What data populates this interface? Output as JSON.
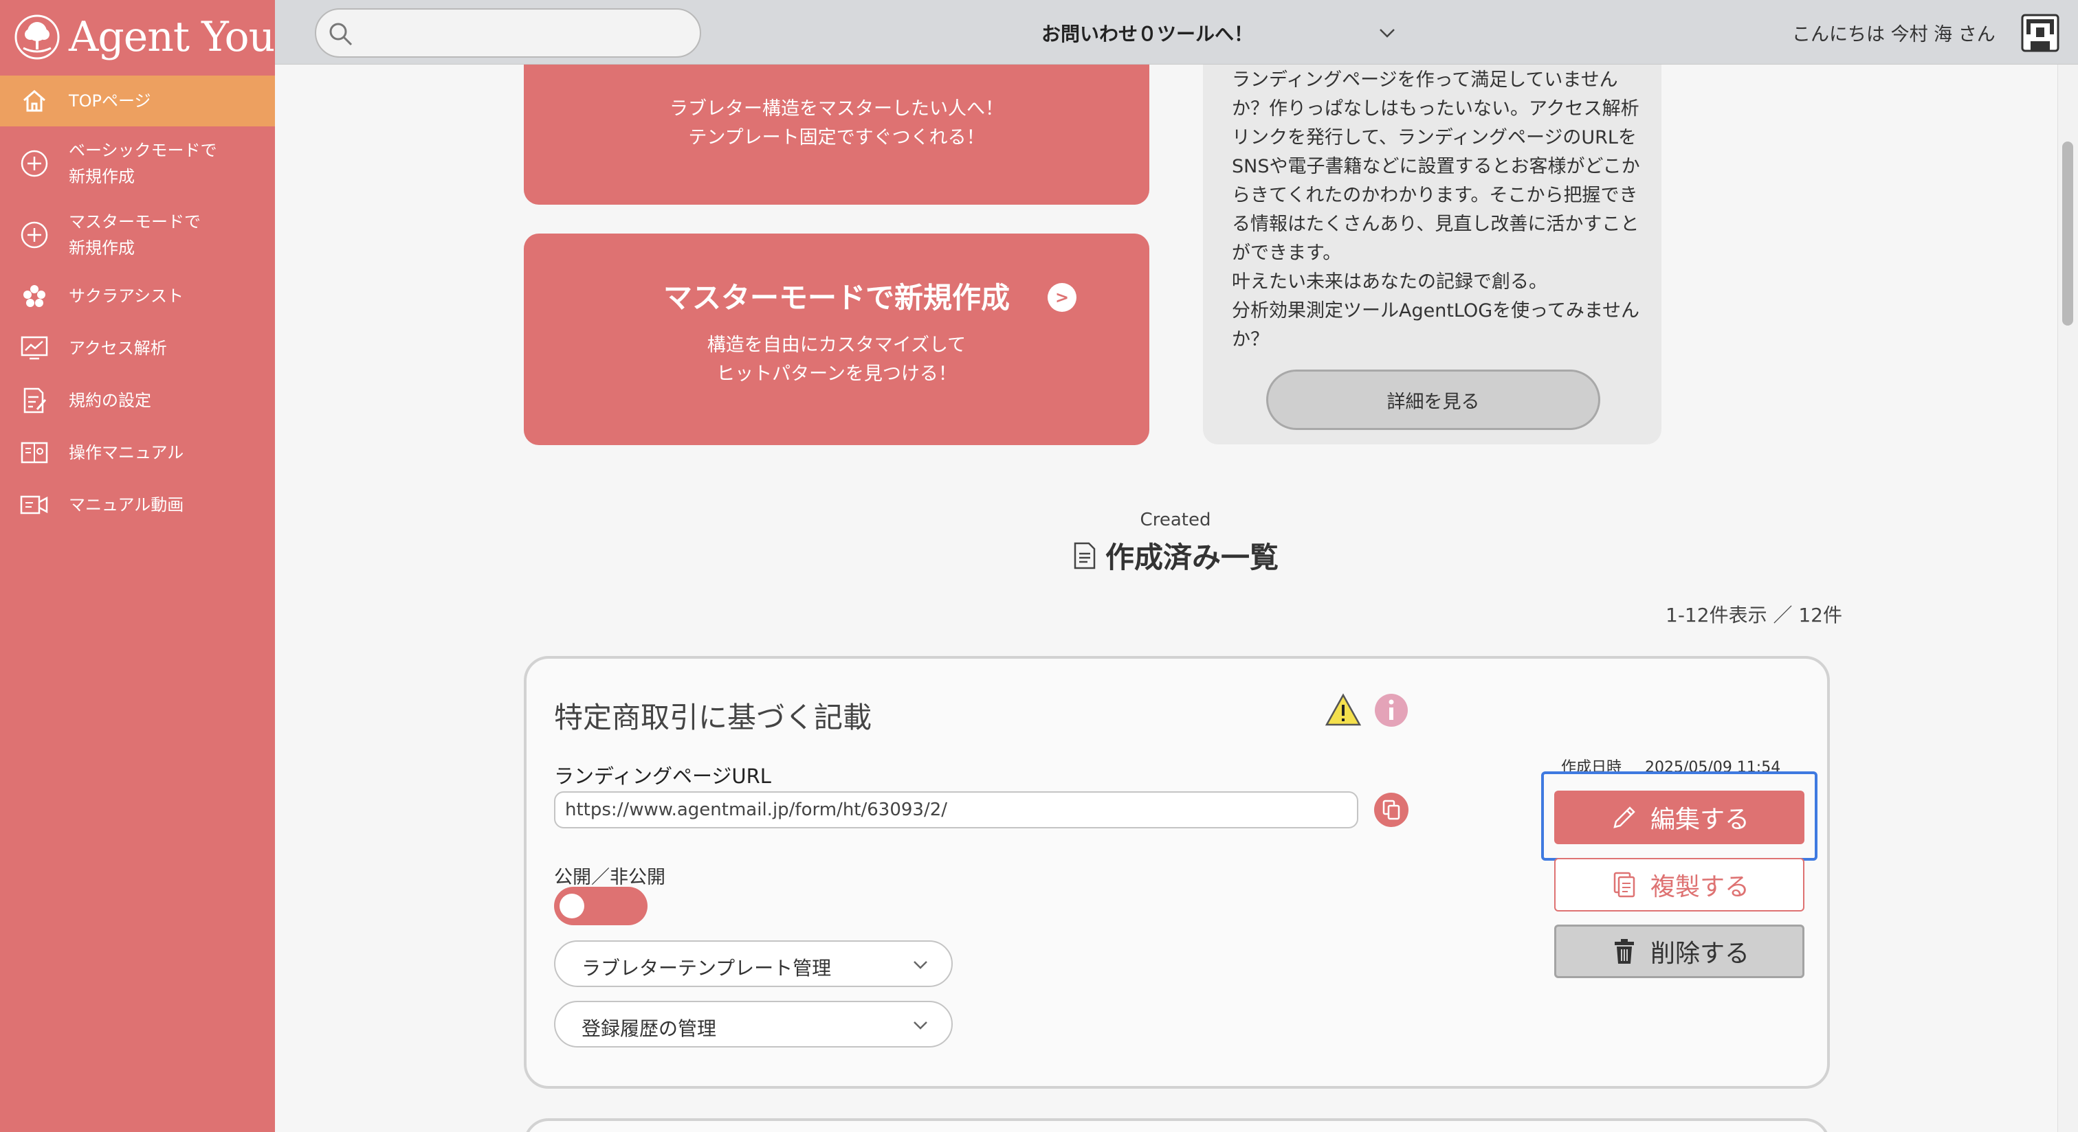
{
  "app": {
    "logo_text": "Agent You"
  },
  "sidebar": {
    "items": [
      {
        "label": "TOPページ",
        "icon": "home-icon",
        "active": true
      },
      {
        "label": "ベーシックモードで\n新規作成",
        "icon": "plus-circle-icon"
      },
      {
        "label": "マスターモードで\n新規作成",
        "icon": "plus-circle-icon"
      },
      {
        "label": "サクラアシスト",
        "icon": "sakura-icon"
      },
      {
        "label": "アクセス解析",
        "icon": "analytics-icon"
      },
      {
        "label": "規約の設定",
        "icon": "document-edit-icon"
      },
      {
        "label": "操作マニュアル",
        "icon": "manual-icon"
      },
      {
        "label": "マニュアル動画",
        "icon": "video-icon"
      }
    ]
  },
  "topbar": {
    "search_placeholder": "",
    "inquiry_label": "お問いわせ０ツールへ！",
    "greeting": "こんにちは 今村 海 さん"
  },
  "cards": {
    "basic": {
      "subtitle": "ラブレター構造をマスターしたい人へ！\nテンプレート固定ですぐつくれる！"
    },
    "master": {
      "title": "マスターモードで新規作成",
      "subtitle": "構造を自由にカスタマイズして\nヒットパターンを見つける！",
      "arrow": ">"
    },
    "info": {
      "text": "ランディングページを作って満足していませんか？作りっぱなしはもったいない。アクセス解析リンクを発行して、ランディングページのURLをSNSや電子書籍などに設置するとお客様がどこからきてくれたのかわかります。そこから把握できる情報はたくさんあり、見直し改善に活かすことができます。\n叶えたい未来はあなたの記録で創る。\n分析効果測定ツールAgentLOGを使ってみませんか？",
      "button": "詳細を見る"
    }
  },
  "created_section": {
    "label_en": "Created",
    "title": "作成済み一覧",
    "count_text": "1-12件表示 ／ 12件"
  },
  "item": {
    "title": "特定商取引に基づく記載",
    "url_label": "ランディングページURL",
    "url_value": "https://www.agentmail.jp/form/ht/63093/2/",
    "public_label": "公開／非公開",
    "public_on": false,
    "select_template": "ラブレターテンプレート管理",
    "select_history": "登録履歴の管理",
    "created_label": "作成日時",
    "created_value": "2025/05/09 11:54",
    "edit_button": "編集する",
    "copy_button": "複製する",
    "delete_button": "削除する"
  },
  "colors": {
    "accent": "#de7272",
    "active_nav": "#eda060",
    "highlight": "#3f7ae0"
  }
}
